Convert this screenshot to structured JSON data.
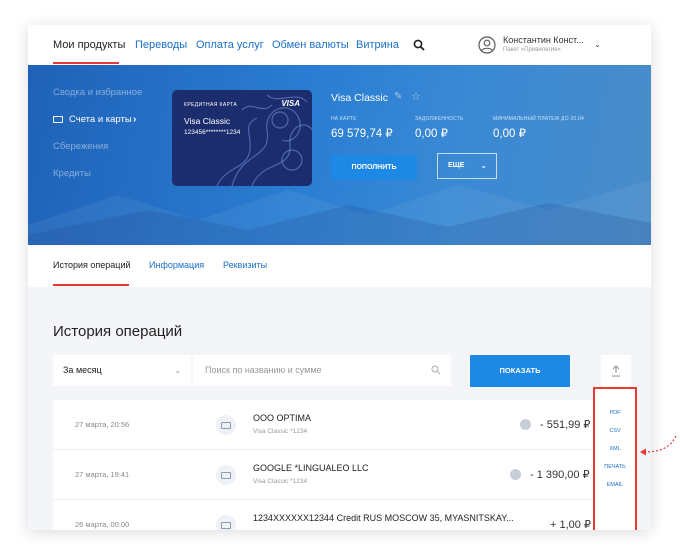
{
  "nav": {
    "items": [
      "Мои продукты",
      "Переводы",
      "Оплата услуг",
      "Обмен валюты",
      "Витрина"
    ],
    "user_name": "Константин Конст...",
    "user_package": "Пакет «Привилегия»"
  },
  "sidebar": {
    "items": [
      "Сводка и избранное",
      "Счета и карты",
      "Сбережения",
      "Кредиты"
    ],
    "active_index": 1
  },
  "card": {
    "label": "КРЕДИТНАЯ КАРТА",
    "brand": "VISA",
    "name": "Visa Classic",
    "number": "123456********1234"
  },
  "account": {
    "title": "Visa Classic",
    "stats": [
      {
        "label": "НА КАРТЕ",
        "value": "69 579,74 ₽"
      },
      {
        "label": "ЗАДОЛЖЕННОСТЬ",
        "value": "0,00 ₽"
      },
      {
        "label": "МИНИМАЛЬНЫЙ ПЛАТЕЖ ДО 20.04",
        "value": "0,00 ₽"
      }
    ],
    "topup_label": "ПОПОЛНИТЬ",
    "more_label": "ЕЩЕ"
  },
  "tabs": [
    "История операций",
    "Информация",
    "Реквизиты"
  ],
  "history": {
    "title": "История операций",
    "period": "За месяц",
    "search_placeholder": "Поиск по названию и сумме",
    "show_label": "ПОКАЗАТЬ",
    "rows": [
      {
        "date": "27 марта, 20:56",
        "merchant": "OOO OPTIMA",
        "card": "Visa Classic *1234",
        "amount": "- 551,99 ₽"
      },
      {
        "date": "27 марта, 19:41",
        "merchant": "GOOGLE *LINGUALEO LLC",
        "card": "Visa Classic *1234",
        "amount": "- 1 390,00 ₽"
      },
      {
        "date": "26 марта, 00:00",
        "merchant": "1234XXXXXX12344 Credit RUS MOSCOW 35, MYASNITSKAY...",
        "card": "",
        "amount": "+ 1,00 ₽"
      }
    ]
  },
  "export": {
    "items": [
      "PDF",
      "CSV",
      "XML",
      "ПЕЧАТЬ",
      "EMAIL"
    ]
  },
  "colors": {
    "accent": "#1e88e5",
    "link": "#1a6fc7",
    "highlight": "#e53935"
  }
}
